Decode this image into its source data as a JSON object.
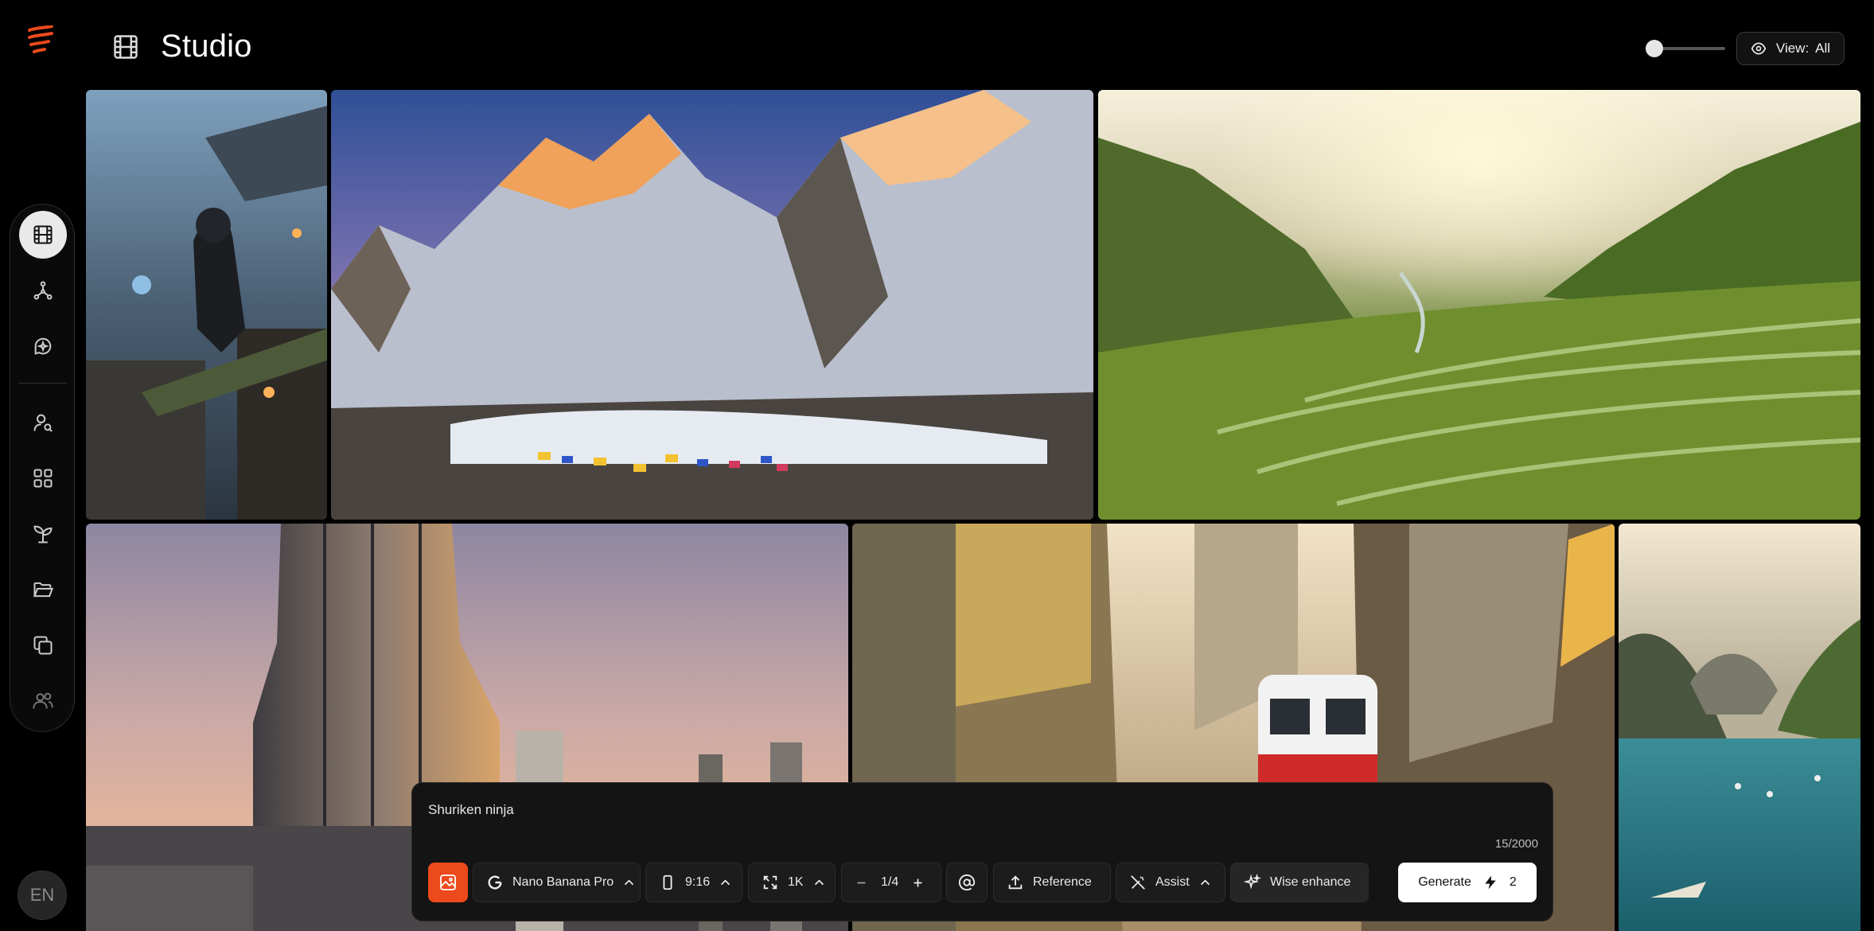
{
  "app": {
    "title": "Studio",
    "logo_icon": "flame-logo-icon",
    "accent_color": "#ec4a1c"
  },
  "header": {
    "view_label": "View:",
    "view_value": "All",
    "zoom_level": 0
  },
  "sidebar": {
    "items": [
      {
        "icon": "film-icon",
        "active": true
      },
      {
        "icon": "workflow-icon",
        "active": false
      },
      {
        "icon": "chat-star-icon",
        "active": false
      },
      {
        "icon": "user-search-icon",
        "active": false
      },
      {
        "icon": "apps-grid-icon",
        "active": false
      },
      {
        "icon": "sprout-icon",
        "active": false
      },
      {
        "icon": "folder-open-icon",
        "active": false
      },
      {
        "icon": "copy-layers-icon",
        "active": false
      },
      {
        "icon": "users-icon",
        "active": false
      }
    ],
    "language": "EN"
  },
  "gallery": {
    "tiles": [
      {
        "subject": "hooded ninja crouching on a temple roof"
      },
      {
        "subject": "snowy mountain peaks with a camp of tents at sunset"
      },
      {
        "subject": "terraced rice fields in a misty valley at sunrise"
      },
      {
        "subject": "skyscraper tower at dusk"
      },
      {
        "subject": "narrow street with a red train passing old shops"
      },
      {
        "subject": "limestone cliffs and a turquoise lagoon with boats"
      }
    ]
  },
  "composer": {
    "prompt": "Shuriken ninja",
    "char_count": "15/2000",
    "model": "Nano Banana Pro",
    "aspect_ratio": "9:16",
    "resolution": "1K",
    "count": "1/4",
    "reference_label": "Reference",
    "assist_label": "Assist",
    "enhance_label": "Wise enhance",
    "generate_label": "Generate",
    "credits": "2"
  }
}
